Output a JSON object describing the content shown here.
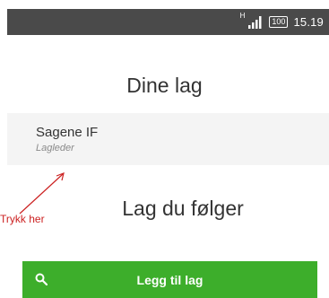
{
  "status_bar": {
    "network_type": "H",
    "signal_icon": "signal-bars-icon",
    "battery_level": "100",
    "time": "15.19"
  },
  "my_teams": {
    "heading": "Dine lag",
    "items": [
      {
        "name": "Sagene IF",
        "role": "Lagleder"
      }
    ]
  },
  "annotation": {
    "text": "Trykk her",
    "color": "#cc2222"
  },
  "followed_teams": {
    "heading": "Lag du følger"
  },
  "add_team_button": {
    "label": "Legg til lag",
    "icon": "search-icon",
    "color": "#3dae2b"
  },
  "colors": {
    "status_bar": "#4a4a4a",
    "card_background": "#f4f4f4"
  }
}
